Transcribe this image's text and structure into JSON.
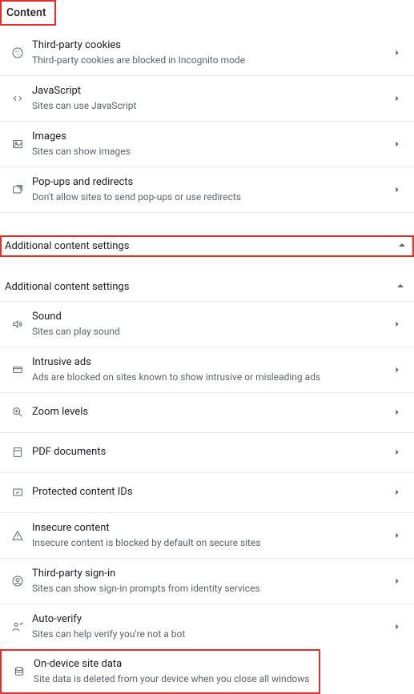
{
  "header": {
    "title": "Content"
  },
  "content_items": [
    {
      "title": "Third-party cookies",
      "sub": "Third-party cookies are blocked in Incognito mode"
    },
    {
      "title": "JavaScript",
      "sub": "Sites can use JavaScript"
    },
    {
      "title": "Images",
      "sub": "Sites can show images"
    },
    {
      "title": "Pop-ups and redirects",
      "sub": "Don't allow sites to send pop-ups or use redirects"
    }
  ],
  "additional_label_1": "Additional content settings",
  "additional_label_2": "Additional content settings",
  "additional_items": [
    {
      "title": "Sound",
      "sub": "Sites can play sound"
    },
    {
      "title": "Intrusive ads",
      "sub": "Ads are blocked on sites known to show intrusive or misleading ads"
    },
    {
      "title": "Zoom levels",
      "sub": ""
    },
    {
      "title": "PDF documents",
      "sub": ""
    },
    {
      "title": "Protected content IDs",
      "sub": ""
    },
    {
      "title": "Insecure content",
      "sub": "Insecure content is blocked by default on secure sites"
    },
    {
      "title": "Third-party sign-in",
      "sub": "Sites can show sign-in prompts from identity services"
    },
    {
      "title": "Auto-verify",
      "sub": "Sites can help verify you're not a bot"
    }
  ],
  "ondevice": {
    "title": "On-device site data",
    "sub": "Site data is deleted from your device when you close all windows"
  }
}
